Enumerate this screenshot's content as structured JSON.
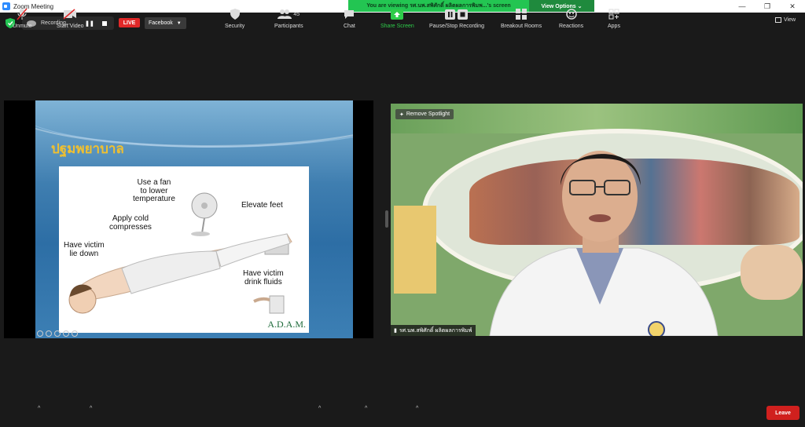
{
  "window": {
    "title": "Zoom Meeting",
    "minimize": "—",
    "restore": "❐",
    "close": "✕"
  },
  "banner": {
    "viewing_text": "You are viewing รศ.นพ.สพิศักดิ์ ผลิตผลการพิมพ...'s screen",
    "view_options": "View Options ⌄"
  },
  "top_strip": {
    "recording_label": "Recording...",
    "pause_symbol": "❚❚",
    "live_label": "LIVE",
    "stream_target": "Facebook",
    "view_label": "View"
  },
  "slide": {
    "title": "ปฐมพยาบาล",
    "captions": {
      "fan": "Use a fan\nto lower\ntemperature",
      "compress": "Apply cold\ncompresses",
      "feet": "Elevate feet",
      "lie": "Have victim\nlie down",
      "drink": "Have victim\ndrink fluids"
    },
    "watermark": "A.D.A.M."
  },
  "video": {
    "remove_spotlight": "Remove Spotlight",
    "participant_name": "รศ.นพ.สพิศักดิ์ ผลิตผลการพิมพ์"
  },
  "toolbar": {
    "unmute": "Unmute",
    "start_video": "Start Video",
    "security": "Security",
    "participants": "Participants",
    "participants_count": "45",
    "chat": "Chat",
    "share_screen": "Share Screen",
    "pause_stop_recording": "Pause/Stop Recording",
    "breakout_rooms": "Breakout Rooms",
    "reactions": "Reactions",
    "apps": "Apps",
    "leave": "Leave"
  },
  "colors": {
    "live_red": "#e02828",
    "banner_green": "#23c552",
    "share_green": "#2ecc4a",
    "leave_red": "#d0201e",
    "slide_title_gold": "#f0c030"
  }
}
